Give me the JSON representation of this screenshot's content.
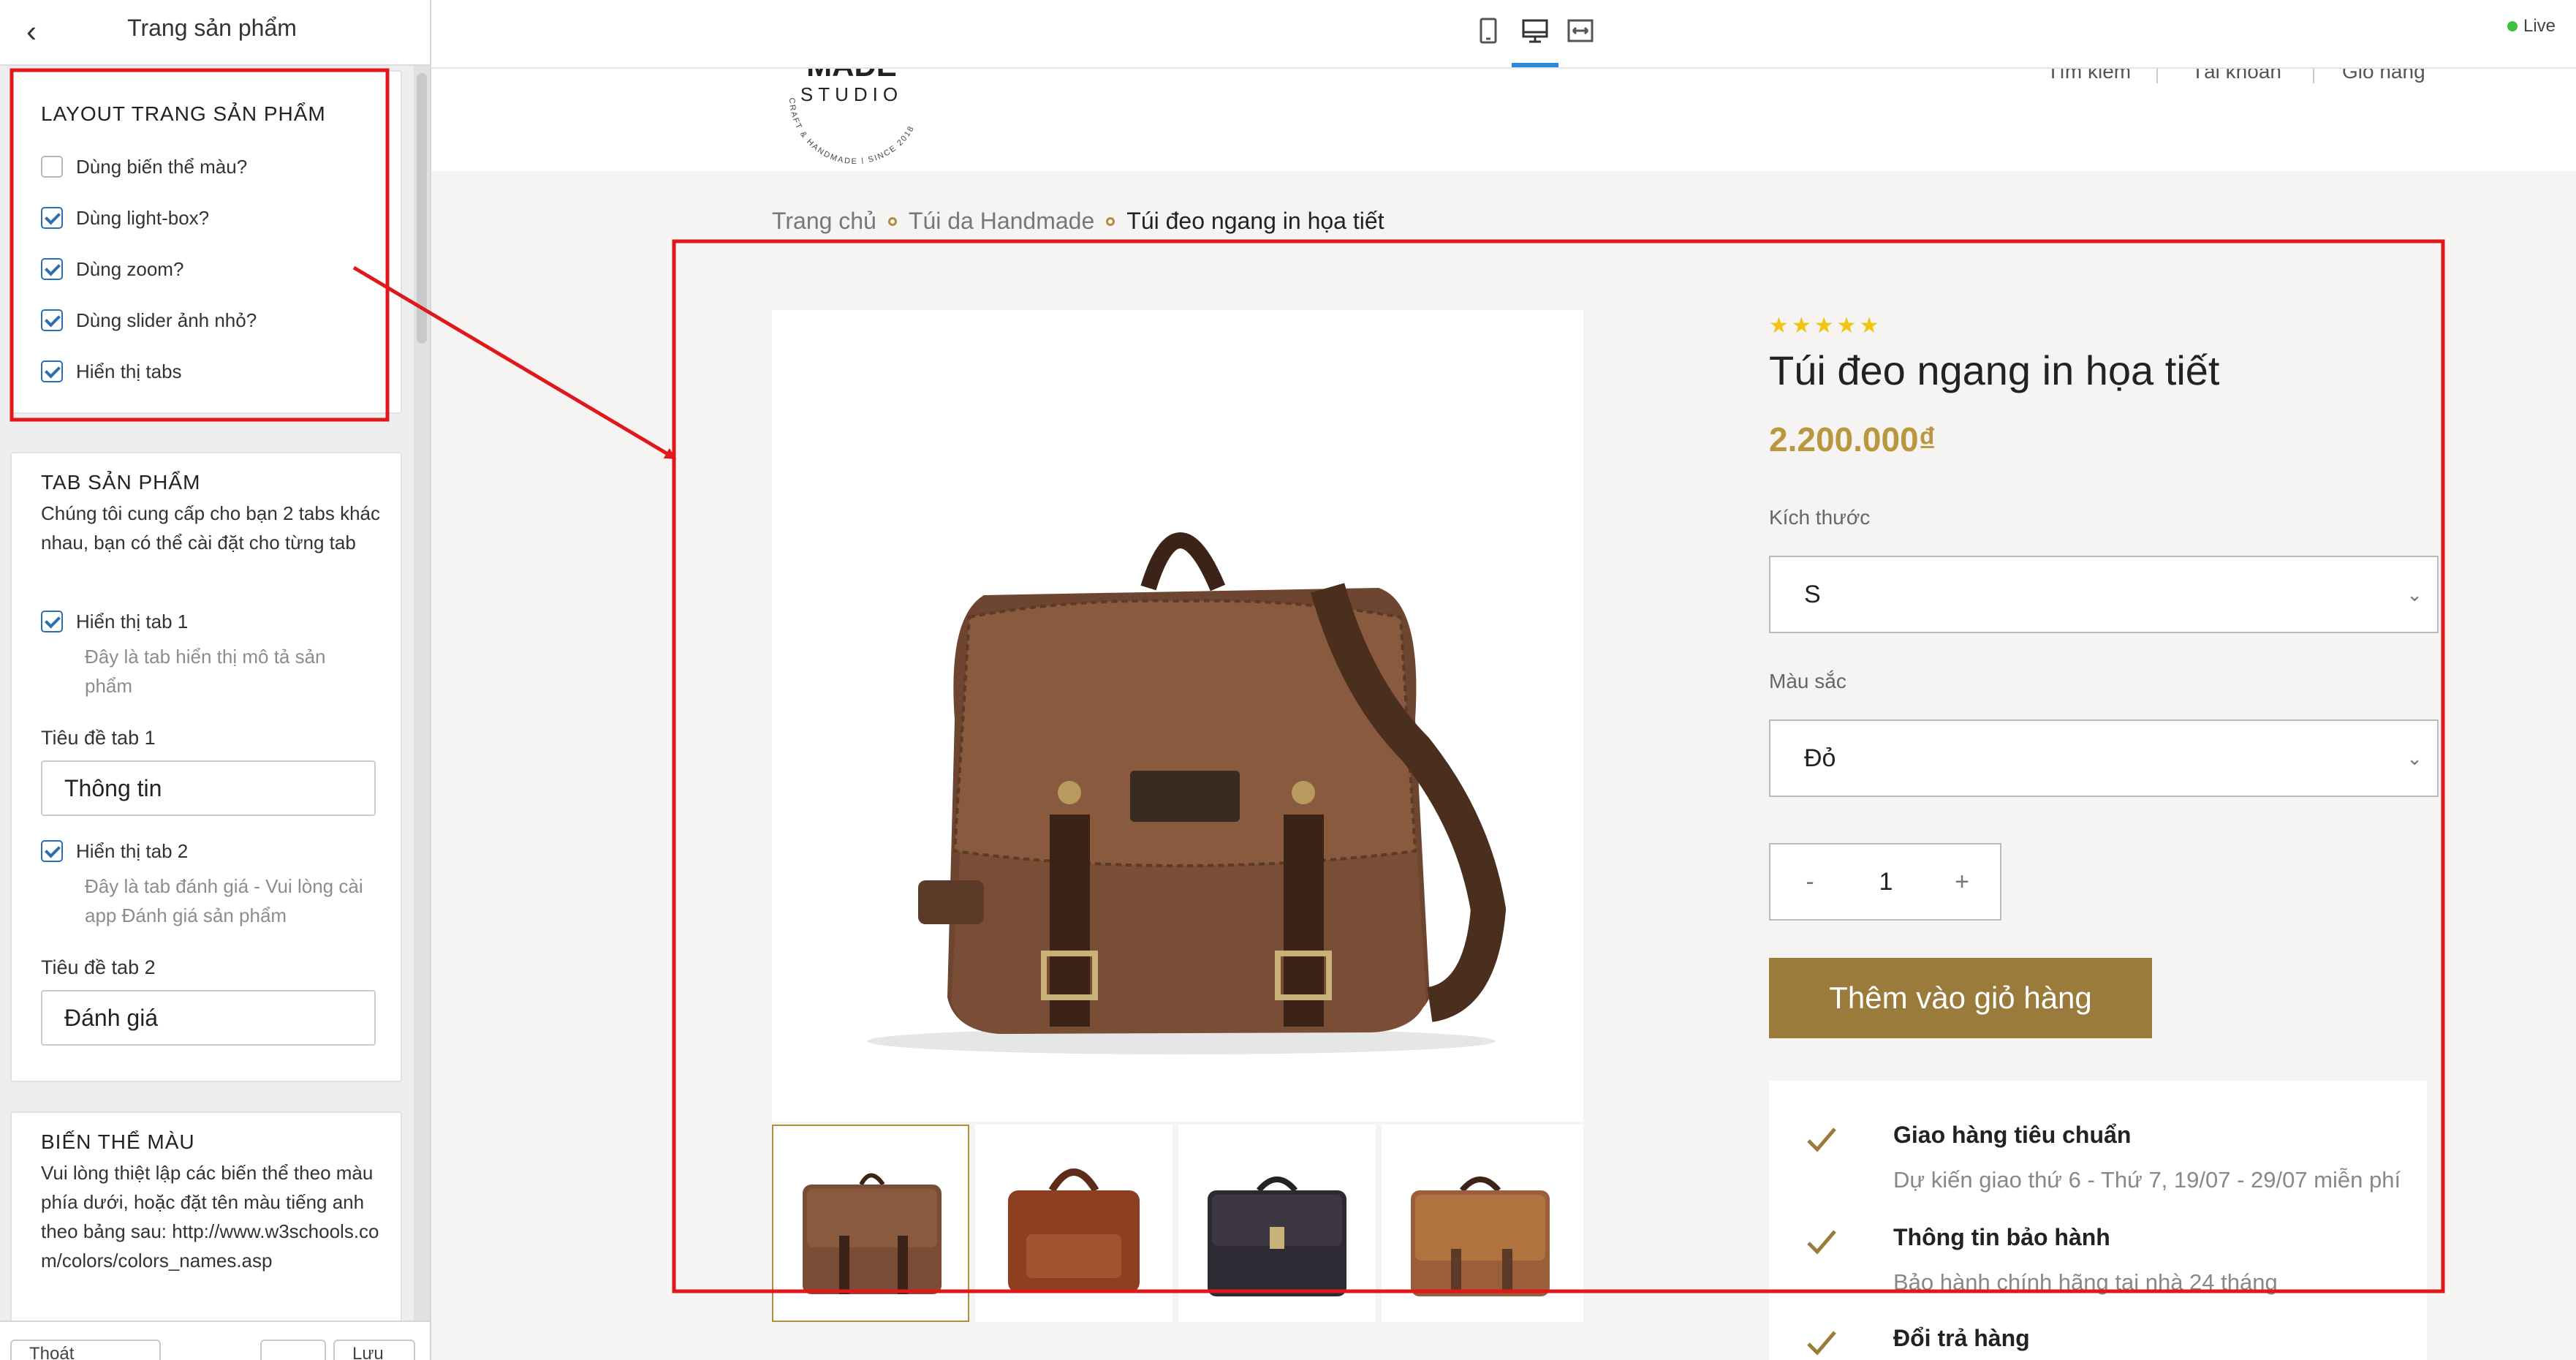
{
  "sidebar": {
    "title": "Trang sản phẩm",
    "layout": {
      "heading": "LAYOUT TRANG SẢN PHẨM",
      "options": [
        {
          "label": "Dùng biến thể màu?",
          "checked": false
        },
        {
          "label": "Dùng light-box?",
          "checked": true
        },
        {
          "label": "Dùng zoom?",
          "checked": true
        },
        {
          "label": "Dùng slider ảnh nhỏ?",
          "checked": true
        },
        {
          "label": "Hiển thị tabs",
          "checked": true
        }
      ]
    },
    "tabs": {
      "heading": "TAB SẢN PHẨM",
      "desc": "Chúng tôi cung cấp cho bạn 2 tabs khác nhau, bạn có thể cài đặt cho từng tab",
      "tab1": {
        "label": "Hiển thị tab 1",
        "checked": true,
        "hint": "Đây là tab hiển thị mô tả sản phẩm",
        "title_label": "Tiêu đề tab 1",
        "title_value": "Thông tin"
      },
      "tab2": {
        "label": "Hiển thị tab 2",
        "checked": true,
        "hint": "Đây là tab đánh giá - Vui lòng cài app Đánh giá sản phẩm",
        "title_label": "Tiêu đề tab 2",
        "title_value": "Đánh giá"
      }
    },
    "variants": {
      "heading": "BIẾN THỂ MÀU",
      "desc": "Vui lòng thiệt lập các biến thể theo màu phía dưới, hoặc đặt tên màu tiếng anh theo bảng sau:",
      "link": "http://www.w3schools.com/colors/colors_names.asp"
    },
    "footer": {
      "left": "Thoát",
      "right": "Lưu"
    }
  },
  "topbar": {
    "devices": [
      "mobile-icon",
      "desktop-icon",
      "fullwidth-icon"
    ],
    "active_device": "desktop-icon",
    "live_label": "Live",
    "live_color": "#3ec13e"
  },
  "store": {
    "logo": {
      "line1": "MADE",
      "line2": "STUDIO",
      "ring_text": "CRAFT & HANDMADE | SINCE 2018"
    },
    "nav": [
      "Tìm kiếm",
      "Tài khoản",
      "Giỏ hàng"
    ],
    "breadcrumb": [
      "Trang chủ",
      "Túi da Handmade",
      "Túi đeo ngang in họa tiết"
    ]
  },
  "product": {
    "rating": 5,
    "stars_text": "★★★★★",
    "title": "Túi đeo ngang in họa tiết",
    "price": "2.200.000₫",
    "size_label": "Kích thước",
    "size_value": "S",
    "color_label": "Màu sắc",
    "color_value": "Đỏ",
    "qty_minus": "-",
    "qty_plus": "+",
    "quantity": "1",
    "add_to_cart": "Thêm vào giỏ hàng",
    "accent_color": "#9b7b3c",
    "price_color": "#b9973e",
    "info": [
      {
        "title": "Giao hàng tiêu chuẩn",
        "desc": "Dự kiến giao thứ 6 - Thứ 7, 19/07 - 29/07 miễn phí"
      },
      {
        "title": "Thông tin bảo hành",
        "desc": "Bảo hành chính hãng tại nhà 24 tháng"
      },
      {
        "title": "Đổi trả hàng",
        "desc": ""
      }
    ]
  },
  "annotation_color": "#e0181c"
}
